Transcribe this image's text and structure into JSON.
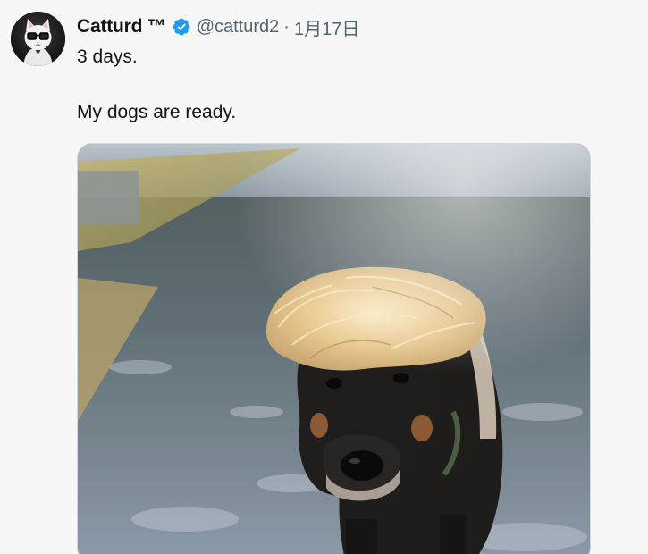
{
  "tweet": {
    "author": {
      "display_name": "Catturd ™",
      "handle": "@catturd2",
      "verified": true,
      "avatar_icon": "cat-with-glasses-avatar"
    },
    "separator": "·",
    "date": "1月17日",
    "text_lines": [
      "3 days.",
      "My dogs are ready."
    ],
    "media": {
      "type": "photo",
      "icon": "dog-wearing-blonde-wig-photo"
    }
  },
  "colors": {
    "verified_badge": "#1d9bf0",
    "secondary_text": "#536471",
    "background": "#f7f7f7"
  }
}
